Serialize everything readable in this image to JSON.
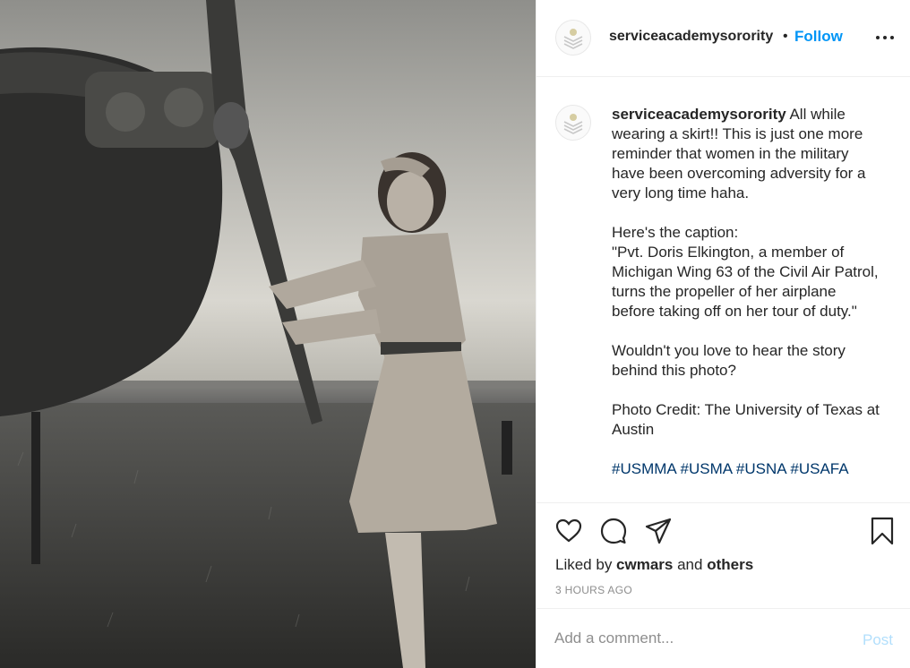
{
  "photo": {
    "alt_icon": "photo-image"
  },
  "header": {
    "username": "serviceacademysorority",
    "separator": "•",
    "follow_label": "Follow",
    "more_icon": "more-options-icon"
  },
  "caption": {
    "username": "serviceacademysorority",
    "text": " All while wearing a skirt!! This is just one more reminder that women in the military have been overcoming adversity for a very long time haha.\n\nHere's the caption:\n\"Pvt. Doris Elkington, a member of Michigan Wing 63 of the Civil Air Patrol, turns the propeller of her airplane before taking off on her tour of duty.\"\n\nWouldn't you love to hear the story behind this photo?\n\nPhoto Credit: The University of Texas at Austin",
    "hashtags": [
      "#USMMA",
      "#USMA",
      "#USNA",
      "#USAFA"
    ]
  },
  "actions": {
    "icons": [
      "heart-icon",
      "comment-icon",
      "share-icon",
      "bookmark-icon"
    ],
    "liked_by_prefix": "Liked by ",
    "liked_by_user": "cwmars",
    "liked_by_mid": " and ",
    "liked_by_others": "others",
    "timestamp": "3 HOURS AGO"
  },
  "comment": {
    "placeholder": "Add a comment...",
    "value": "",
    "post_label": "Post"
  },
  "colors": {
    "follow": "#0095f6",
    "hashtag": "#00376b",
    "post_disabled": "#b2dffc",
    "muted": "#8e8e8e"
  }
}
